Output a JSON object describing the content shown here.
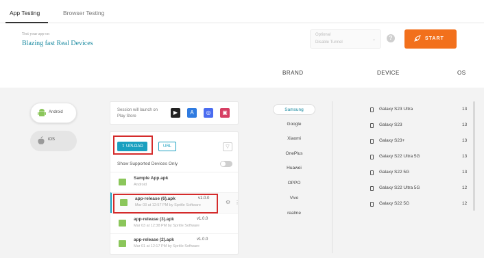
{
  "tabs": [
    {
      "label": "App Testing",
      "active": true
    },
    {
      "label": "Browser Testing",
      "active": false
    }
  ],
  "header": {
    "subtitle": "Test your app on",
    "title": "Blazing fast Real Devices",
    "tunnel": {
      "label": "Optional",
      "value": "Disable Tunnel"
    },
    "help": "?",
    "start_label": "START"
  },
  "columns": {
    "brand": "BRAND",
    "device": "DEVICE",
    "os": "OS"
  },
  "os_options": [
    {
      "label": "Android",
      "icon": "android-icon",
      "selected": true
    },
    {
      "label": "iOS",
      "icon": "apple-icon",
      "selected": false
    }
  ],
  "store": {
    "text": "Session will launch on Play Store",
    "icons": [
      {
        "name": "play-store-icon",
        "glyph": "▶",
        "color": "#222222"
      },
      {
        "name": "app-store-icon",
        "glyph": "A",
        "color": "#2f7be0"
      },
      {
        "name": "browser-icon",
        "glyph": "◎",
        "color": "#4a6cf0"
      },
      {
        "name": "app-icon",
        "glyph": "▣",
        "color": "#d63e63"
      }
    ]
  },
  "upload": {
    "upload_label": "UPLOAD",
    "upload_icon": "⇪",
    "url_label": "URL",
    "filter_icon": "filter-icon",
    "show_supported": "Show Supported Devices Only"
  },
  "apps": [
    {
      "name": "Sample App.apk",
      "meta": "Android",
      "version": "",
      "selected": false
    },
    {
      "name": "app-release (6).apk",
      "meta": "Mar 03 at 12:57 PM by Spritle Software",
      "version": "v1.0.0",
      "selected": true
    },
    {
      "name": "app-release (3).apk",
      "meta": "Mar 03 at 12:38 PM by Spritle Software",
      "version": "v1.0.0",
      "selected": false
    },
    {
      "name": "app-release (2).apk",
      "meta": "Mar 01 at 12:17 PM by Spritle Software",
      "version": "v1.0.0",
      "selected": false
    }
  ],
  "brands": [
    "Samsung",
    "Google",
    "Xiaomi",
    "OnePlus",
    "Huawei",
    "OPPO",
    "Vivo",
    "realme"
  ],
  "selected_brand": "Samsung",
  "devices": [
    {
      "name": "Galaxy S23 Ultra",
      "os": "13"
    },
    {
      "name": "Galaxy S23",
      "os": "13"
    },
    {
      "name": "Galaxy S23+",
      "os": "13"
    },
    {
      "name": "Galaxy S22 Ultra 5G",
      "os": "13"
    },
    {
      "name": "Galaxy S22 5G",
      "os": "13"
    },
    {
      "name": "Galaxy S22 Ultra 5G",
      "os": "12"
    },
    {
      "name": "Galaxy S22 5G",
      "os": "12"
    }
  ],
  "colors": {
    "accent": "#1aa0c0",
    "start": "#f2701c",
    "highlight": "#d42b2b",
    "app_icon": "#8bc65b"
  }
}
